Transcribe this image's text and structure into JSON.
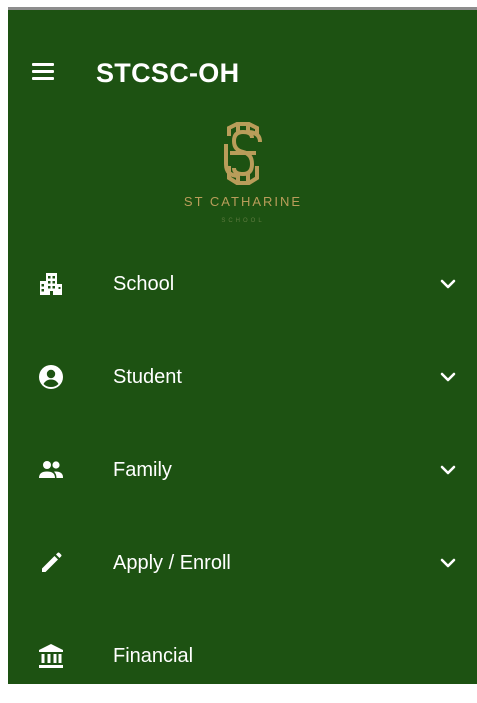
{
  "app": {
    "title": "STCSC-OH"
  },
  "logo": {
    "name": "ST CATHARINE",
    "subtitle": "SCHOOL",
    "icon": "school-crest-icon"
  },
  "colors": {
    "sidebar_bg": "#1d5212",
    "text": "#ffffff",
    "logo_gold": "#b99d5a"
  },
  "nav": {
    "items": [
      {
        "label": "School",
        "icon": "building-icon",
        "expandable": true
      },
      {
        "label": "Student",
        "icon": "account-circle-icon",
        "expandable": true
      },
      {
        "label": "Family",
        "icon": "people-icon",
        "expandable": true
      },
      {
        "label": "Apply / Enroll",
        "icon": "pencil-icon",
        "expandable": true
      },
      {
        "label": "Financial",
        "icon": "bank-icon",
        "expandable": false
      }
    ]
  }
}
